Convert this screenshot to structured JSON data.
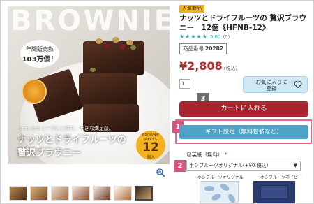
{
  "hero": {
    "big_word": "BROWNIE",
    "sales_badge_line1": "年間販売数",
    "sales_badge_line2": "103万個！",
    "cube_note": "4cm のキューブに心弾む、大きな満足感。",
    "title_line1": "ナッツとドライフルーツの",
    "title_line2": "贅沢ブラウニー",
    "count_small": "BROWNIE PIECES",
    "count_number": "12",
    "count_unit": "個入"
  },
  "zoom_icon": "zoom-in-icon",
  "thumbnails_count": 8,
  "product": {
    "badge": "人気商品",
    "title": "ナッツとドライフルーツの 贅沢ブラウニー　12個《HFNB-12》",
    "stars": "★★★★★",
    "rating": "5.00",
    "reviews": "(6)",
    "code_label": "商品番号",
    "code_value": "20282",
    "price": "¥2,808",
    "price_tax": "(税込)",
    "qty": "1",
    "favorite_label": "お気に入りに登録",
    "cart_label": "カートに入れる",
    "gift_label": "ギフト設定（無料包装など）",
    "wrap_label": "包装紙（無料）",
    "wrap_required": "*",
    "wrap_selected": "ホシフルーツオリジナル(+¥0 税込)",
    "wrap_option1": "ホシフルーツオリジナル",
    "wrap_option2": "ホシフルーツネイビー"
  },
  "steps": {
    "s1": "1",
    "s2": "2",
    "s3": "3"
  },
  "colors": {
    "accent_red": "#a8252f",
    "gift_blue": "#4fa3c9",
    "highlight_pink": "#e16b93",
    "badge_yellow": "#f2b21e"
  }
}
